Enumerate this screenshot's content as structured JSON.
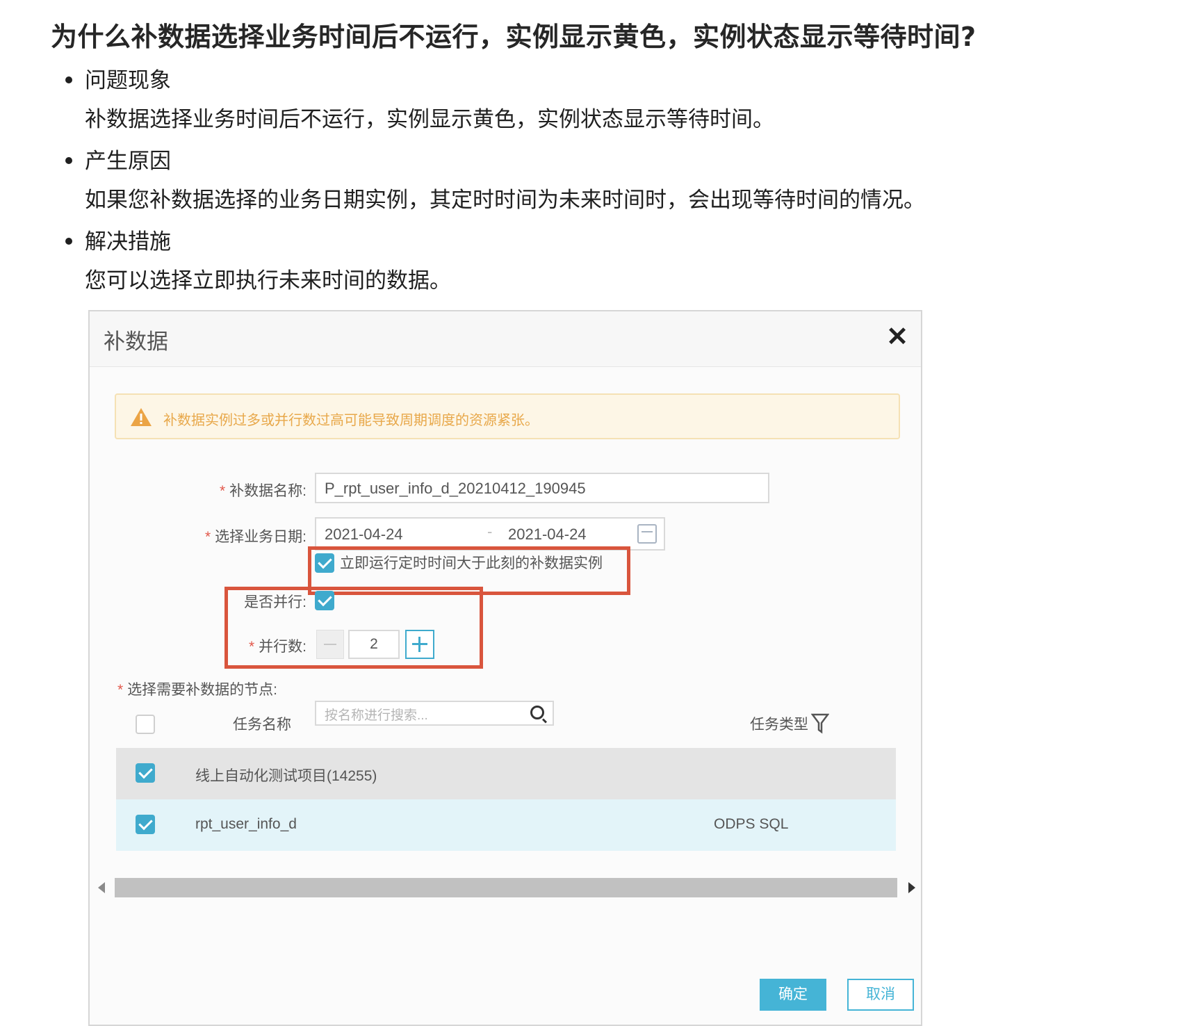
{
  "article": {
    "title": "为什么补数据选择业务时间后不运行，实例显示黄色，实例状态显示等待时间?",
    "items": [
      {
        "heading": "问题现象",
        "body": "补数据选择业务时间后不运行，实例显示黄色，实例状态显示等待时间。"
      },
      {
        "heading": "产生原因",
        "body": "如果您补数据选择的业务日期实例，其定时时间为未来时间时，会出现等待时间的情况。"
      },
      {
        "heading": "解决措施",
        "body": "您可以选择立即执行未来时间的数据。"
      }
    ]
  },
  "dialog": {
    "title": "补数据",
    "close_icon": "✕",
    "warning": "补数据实例过多或并行数过高可能导致周期调度的资源紧张。",
    "name_label": "补数据名称:",
    "name_value": "P_rpt_user_info_d_20210412_190945",
    "date_label": "选择业务日期:",
    "date_start": "2021-04-24",
    "date_sep": "-",
    "date_end": "2021-04-24",
    "run_now_checked": true,
    "run_now_label": "立即运行定时时间大于此刻的补数据实例",
    "parallel_label": "是否并行:",
    "parallel_checked": true,
    "parallel_count_label": "并行数:",
    "parallel_count_value": "2",
    "nodes_label": "选择需要补数据的节点:",
    "table": {
      "col_name": "任务名称",
      "search_placeholder": "按名称进行搜索...",
      "col_type": "任务类型",
      "rows": [
        {
          "checked": true,
          "name": "线上自动化测试项目(14255)",
          "type": ""
        },
        {
          "checked": true,
          "name": "rpt_user_info_d",
          "type": "ODPS SQL"
        }
      ]
    },
    "ok_label": "确定",
    "cancel_label": "取消",
    "accent_color": "#45b4d6",
    "highlight_color": "#d9553d"
  }
}
